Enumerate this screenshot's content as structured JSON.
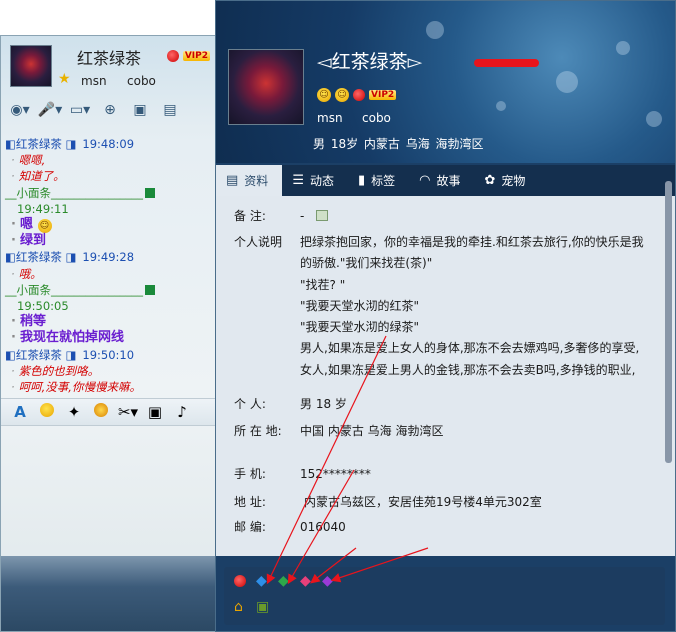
{
  "chat_window": {
    "contact_name": "红茶绿茶",
    "vip": "VIP2",
    "status_items": [
      "msn",
      "cobo"
    ],
    "messages": [
      {
        "sender": "红茶绿茶",
        "time": "19:48:09",
        "lines": [
          "嗯嗯,",
          "知道了。"
        ],
        "side": "her"
      },
      {
        "sender": "小面条",
        "time": "19:49:11",
        "lines": [
          "嗯",
          "绿到"
        ],
        "side": "me"
      },
      {
        "sender": "红茶绿茶",
        "time": "19:49:28",
        "lines": [
          "哦。"
        ],
        "side": "her"
      },
      {
        "sender": "小面条",
        "time": "19:50:05",
        "lines": [
          "稍等",
          "我现在就怕掉网线"
        ],
        "side": "me"
      },
      {
        "sender": "红茶绿茶",
        "time": "19:50:10",
        "lines": [
          "紫色的也到咯。",
          "呵呵,没事,你慢慢来嘛。"
        ],
        "side": "her"
      }
    ]
  },
  "profile": {
    "name": "红茶绿茶",
    "vip": "VIP2",
    "msn": "msn",
    "cobo": "cobo",
    "info_line": "男   18岁   内蒙古 乌海 海勃湾区",
    "tabs": [
      "资料",
      "动态",
      "标签",
      "故事",
      "宠物"
    ],
    "active_tab": "资料",
    "fields": {
      "note_label": "备    注:",
      "note_value": "-",
      "bio_label": "个人说明",
      "bio_lines": [
        "把绿茶抱回家，你的幸福是我的牵挂.和红茶去旅行,你的快乐是我",
        "的骄傲.\"我们来找茬(茶)\"",
        "\"找茬? \"",
        "\"我要天堂水沏的红茶\"",
        "\"我要天堂水沏的绿茶\"",
        "男人,如果冻是爱上女人的身体,那冻不会去嫖鸡吗,多奢侈的享受,",
        "女人,如果冻是爱上男人的金钱,那冻不会去卖B吗,多挣钱的职业,"
      ],
      "person_label": "个    人:",
      "person_value": "男   18 岁",
      "location_label": "所 在 地:",
      "location_value": "中国 内蒙古 乌海 海勃湾区",
      "phone_label": "手    机:",
      "phone_value": "152********",
      "address_label": "地    址:",
      "address_value": "内蒙古乌兹区，安居佳苑19号楼4单元302室",
      "zip_label": "邮    编:",
      "zip_value": "016040"
    },
    "badge_icons": [
      "qq-pet-icon",
      "blue-diamond-icon",
      "green-diamond-icon",
      "red-diamond-icon",
      "purple-diamond-icon",
      "house-icon",
      "gift-box-icon"
    ]
  },
  "colors": {
    "her_header": "#1c4fb1",
    "her_text": "#d40000",
    "me_header": "#2a8a2a",
    "me_text": "#6a1ed0",
    "annotation_red": "#e8141c"
  }
}
